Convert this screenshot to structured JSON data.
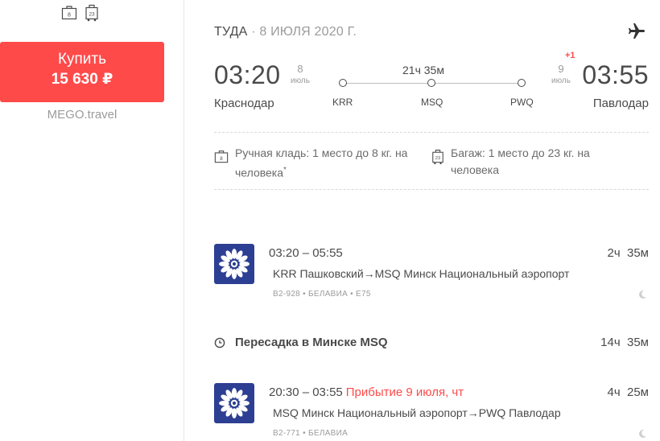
{
  "sidebar": {
    "icons": [
      "hand-luggage-icon",
      "checked-baggage-icon"
    ],
    "hand_icon_label": "8",
    "check_icon_label": "23",
    "buy_label": "Купить",
    "price": "15 630 ₽",
    "vendor": "MEGO.travel"
  },
  "flight": {
    "direction": "ТУДА",
    "separator": " · ",
    "date": "8 ИЮЛЯ 2020 Г.",
    "departure": {
      "time": "03:20",
      "day": "8",
      "month": "июль",
      "city": "Краснодар"
    },
    "arrival": {
      "time": "03:55",
      "day": "9",
      "month": "июль",
      "city": "Павлодар",
      "day_offset": "+1"
    },
    "duration": "21ч 35м",
    "stops": [
      "KRR",
      "MSQ",
      "PWQ"
    ],
    "baggage": {
      "hand": "Ручная кладь: 1 место до 8 кг. на человека",
      "hand_mark": "*",
      "checked": "Багаж: 1 место до 23 кг. на человека"
    }
  },
  "segments": [
    {
      "times": "03:20 – 05:55",
      "arrival_note": "",
      "duration": "2ч  35м",
      "route": "KRR Пашковский→MSQ Минск Национальный аэропорт",
      "meta": "B2-928 • БЕЛАВИА • E75"
    },
    {
      "times": "20:30 – 03:55",
      "arrival_note": "Прибытие 9 июля, чт",
      "duration": "4ч  25м",
      "route": "MSQ Минск Национальный аэропорт→PWQ Павлодар",
      "meta": "B2-771 • БЕЛАВИА"
    }
  ],
  "layover": {
    "text": "Пересадка в Минске MSQ",
    "duration": "14ч  35м"
  },
  "colors": {
    "accent": "#ff4a4a",
    "airline": "#2c3f92",
    "text": "#4a4a4a",
    "muted": "#9b9b9b"
  }
}
